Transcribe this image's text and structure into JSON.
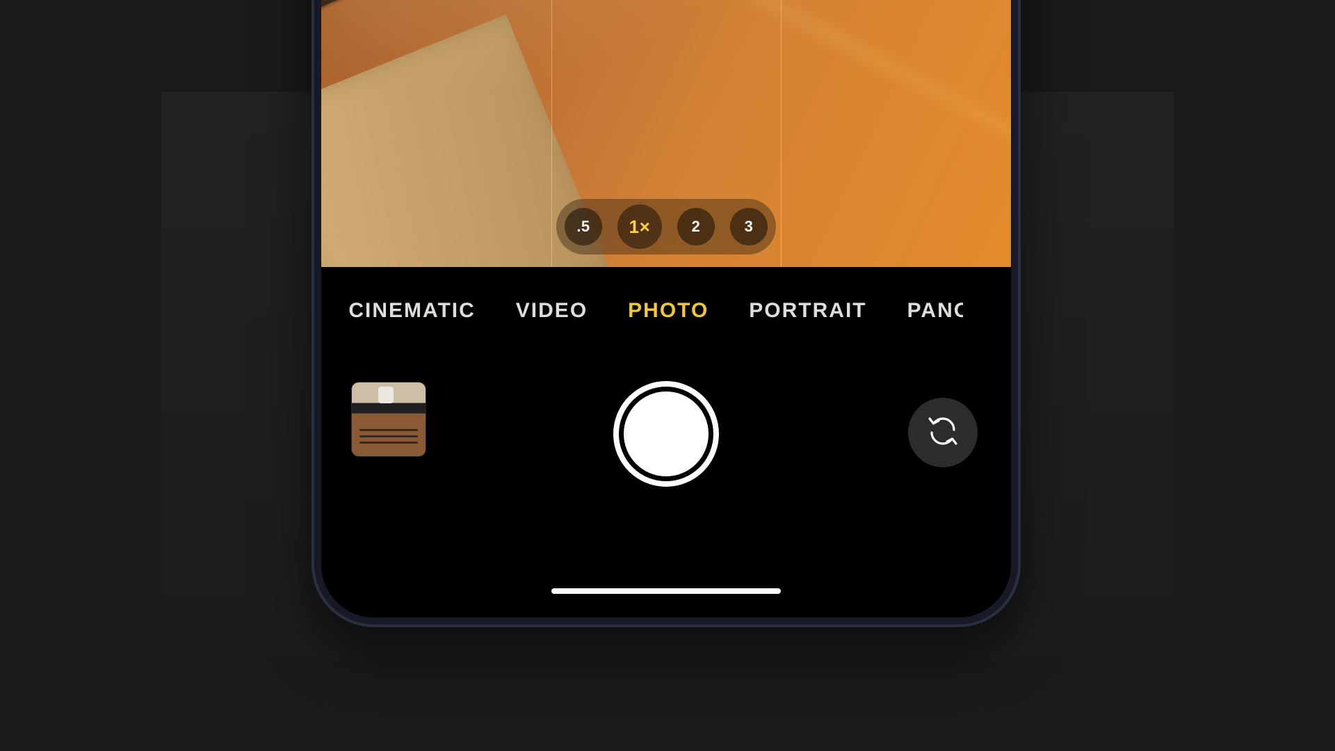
{
  "zoom": {
    "options": [
      ".5",
      "1×",
      "2",
      "3"
    ],
    "active_index": 1
  },
  "modes": {
    "items": [
      "CINEMATIC",
      "VIDEO",
      "PHOTO",
      "PORTRAIT",
      "PANO"
    ],
    "active_index": 2
  },
  "colors": {
    "accent": "#ffd23a"
  }
}
